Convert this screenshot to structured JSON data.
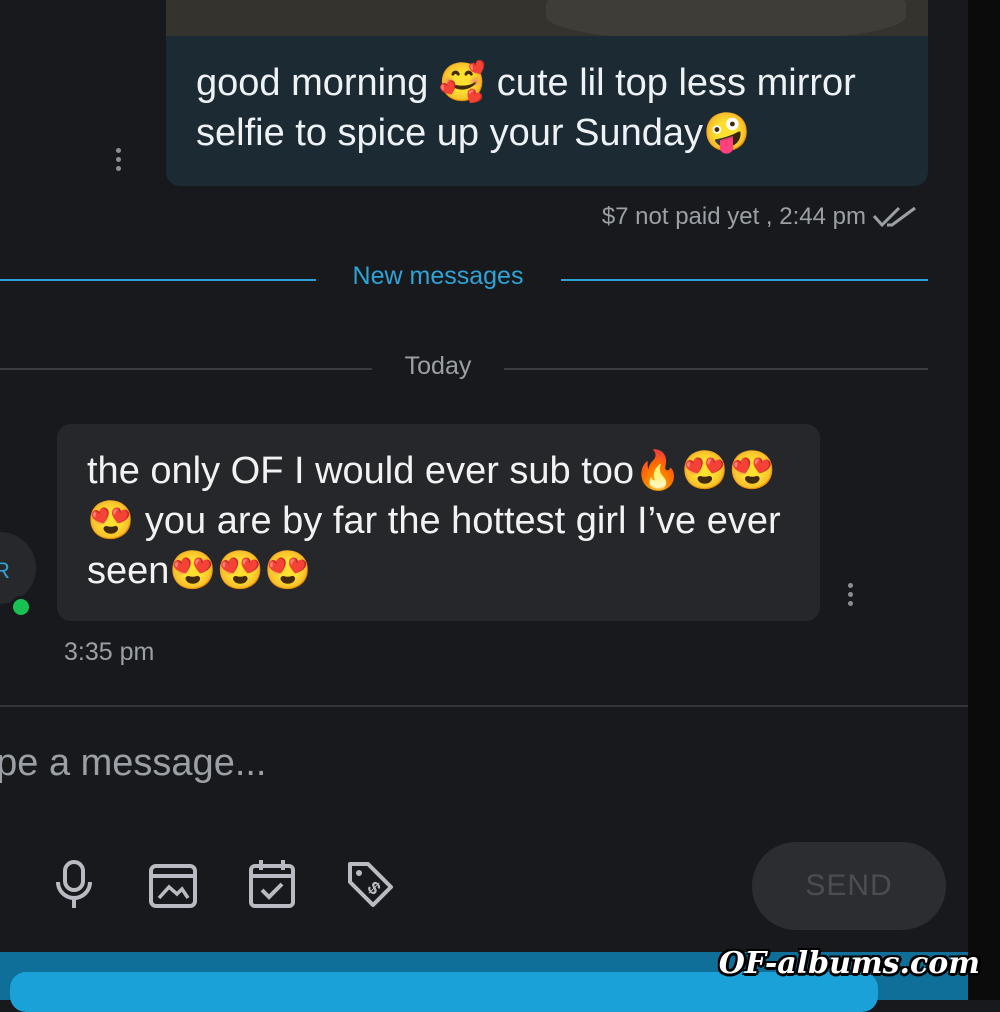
{
  "conversation": {
    "outgoing": {
      "text": "good morning 🥰 cute lil top less mirror selfie to spice up your Sunday🤪",
      "status": "$7 not paid yet , 2:44 pm"
    },
    "new_messages_label": "New messages",
    "day_separator": "Today",
    "incoming": {
      "avatar_initial": "R",
      "text": "the only OF I would ever sub too🔥😍😍😍 you are by far the hottest girl I’ve ever seen😍😍😍",
      "time": "3:35 pm"
    }
  },
  "composer": {
    "placeholder": "Type a message...",
    "send_label": "SEND",
    "tools": [
      "microphone-icon",
      "media-gallery-icon",
      "calendar-check-icon",
      "price-tag-icon"
    ]
  },
  "watermark": "OF-albums.com",
  "colors": {
    "accent": "#2fa3d6",
    "background": "#18191c",
    "outgoing_bubble": "#1c2a33",
    "incoming_bubble": "#26272b",
    "online": "#17c153"
  }
}
